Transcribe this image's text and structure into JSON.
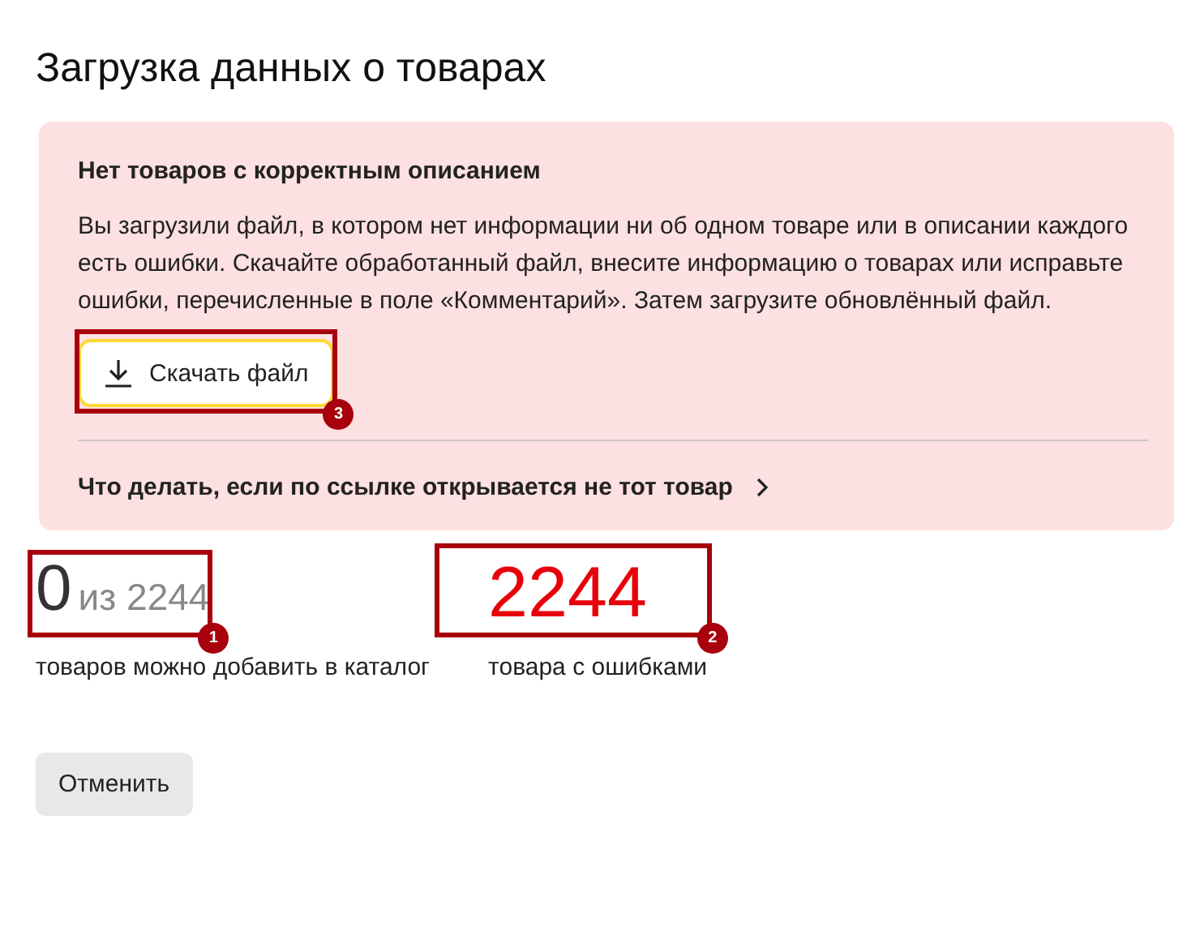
{
  "title": "Загрузка данных о товарах",
  "alert": {
    "heading": "Нет товаров с корректным описанием",
    "message": "Вы загрузили файл, в котором нет информации ни об одном товаре или в описании каждого есть ошибки. Скачайте обработанный файл, внесите информацию о товарах или исправьте ошибки, перечисленные в поле «Комментарий». Затем загрузите обновлённый файл.",
    "download_button": {
      "label": "Скачать файл",
      "focused": true,
      "callout": "3"
    },
    "help_link": "Что делать, если по ссылке открывается не тот товар"
  },
  "stats": [
    {
      "kind": "ratio",
      "value": "0",
      "total": "из 2244",
      "label": "товаров можно добавить в каталог",
      "callout": "1"
    },
    {
      "kind": "error",
      "value": "2244",
      "label": "товара с ошибками",
      "callout": "2"
    }
  ],
  "cancel_button": "Отменить"
}
